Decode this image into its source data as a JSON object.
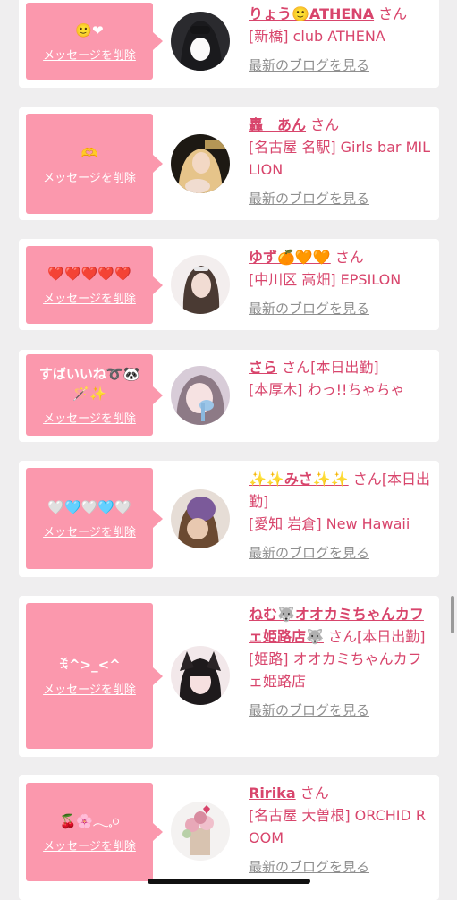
{
  "delete_label": "メッセージを削除",
  "blog_label": "最新のブログを見る",
  "honorific": "さん",
  "cards": [
    {
      "message": "🙂❤",
      "name": "りょう🙂ATHENA",
      "suffix": "",
      "shop": "[新橋] club ATHENA"
    },
    {
      "message": "🫶",
      "name": "轟　あん",
      "suffix": "",
      "shop": "[名古屋 名駅] Girls bar MILLION"
    },
    {
      "message": "❤️❤️❤️❤️❤️",
      "name": "ゆず🍊🧡🧡",
      "suffix": "",
      "shop": "[中川区 高畑] EPSILON"
    },
    {
      "message": "すばいいね➰🐼🪄✨",
      "name": "さら",
      "suffix": "[本日出勤]",
      "shop": "[本厚木] わっ!!ちゃちゃ"
    },
    {
      "message": "🤍🩵🤍🩵🤍",
      "name": "✨✨みさ✨✨",
      "suffix": "[本日出勤]",
      "shop": "[愛知 岩倉] New Hawaii"
    },
    {
      "message": "ꉂ^>_<^",
      "name": "ねむ🐺オオカミちゃんカフェ姫路店🐺",
      "suffix": "[本日出勤]",
      "shop": "[姫路] オオカミちゃんカフェ姫路店"
    },
    {
      "message": "🍒🌸𓂃𓈒𓏸",
      "name": "Ririka",
      "suffix": "",
      "shop": "[名古屋 大曽根] ORCHID ROOM"
    }
  ]
}
